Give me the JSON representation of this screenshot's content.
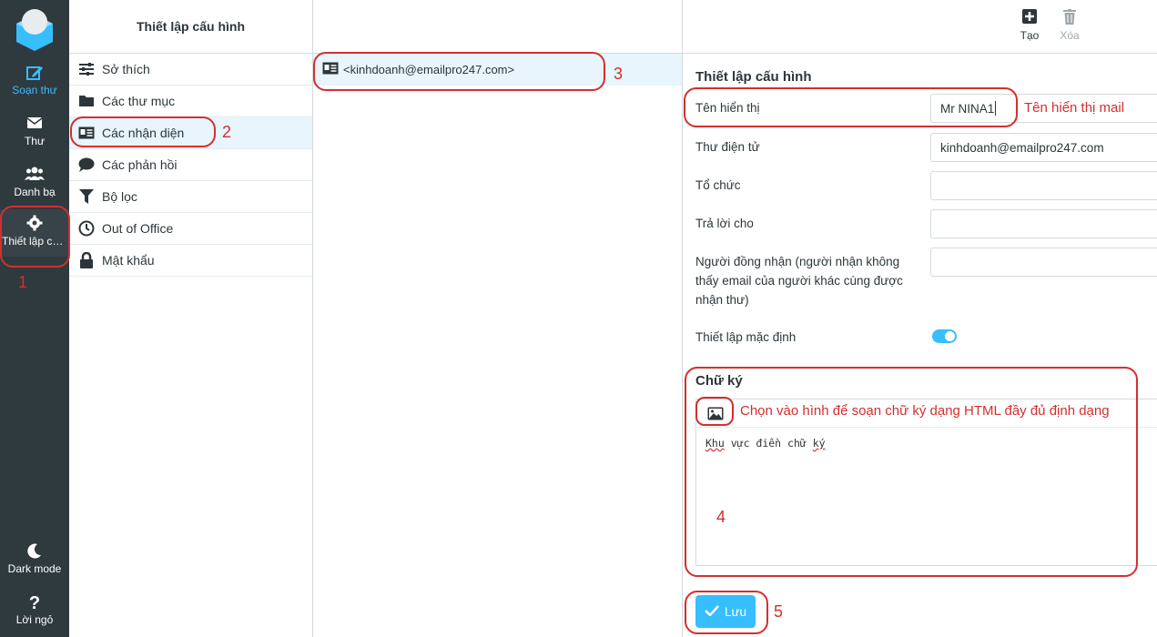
{
  "sidebar": {
    "items": [
      {
        "label": "Soạn thư",
        "icon": "compose-icon"
      },
      {
        "label": "Thư",
        "icon": "mail-icon"
      },
      {
        "label": "Danh bạ",
        "icon": "contacts-icon"
      },
      {
        "label": "Thiết lập cấ...",
        "icon": "gear-icon"
      }
    ],
    "bottom": [
      {
        "label": "Dark mode",
        "icon": "moon-icon"
      },
      {
        "label": "Lời ngỏ",
        "icon": "question-icon"
      }
    ]
  },
  "settings": {
    "title": "Thiết lập cấu hình",
    "items": [
      {
        "label": "Sở thích",
        "icon": "sliders-icon"
      },
      {
        "label": "Các thư mục",
        "icon": "folder-icon"
      },
      {
        "label": "Các nhận diện",
        "icon": "id-card-icon"
      },
      {
        "label": "Các phản hồi",
        "icon": "comment-icon"
      },
      {
        "label": "Bộ lọc",
        "icon": "filter-icon"
      },
      {
        "label": "Out of Office",
        "icon": "clock-icon"
      },
      {
        "label": "Mật khẩu",
        "icon": "lock-icon"
      }
    ]
  },
  "identities": {
    "items": [
      {
        "label": "<kinhdoanh@emailpro247.com>"
      }
    ]
  },
  "toolbar": {
    "create_label": "Tạo",
    "delete_label": "Xóa"
  },
  "form": {
    "title": "Thiết lập cấu hình",
    "fields": {
      "display_name": {
        "label": "Tên hiển thị",
        "value": "Mr NINA1"
      },
      "email": {
        "label": "Thư điện tử",
        "value": "kinhdoanh@emailpro247.com"
      },
      "organization": {
        "label": "Tổ chức",
        "value": ""
      },
      "reply_to": {
        "label": "Trả lời cho",
        "value": ""
      },
      "bcc": {
        "label": "Người đồng nhận (người nhận không thấy email của người khác cùng được nhận thư)",
        "value": ""
      }
    },
    "default_label": "Thiết lập mặc định",
    "default_on": true,
    "signature_title": "Chữ ký",
    "signature_text_1": "Khu",
    "signature_text_2": "vực điền chữ",
    "signature_text_3": "ký",
    "save_label": "Lưu"
  },
  "annotations": {
    "n1": "1",
    "n2": "2",
    "n3": "3",
    "n4": "4",
    "n5": "5",
    "display_name_hint": "Tên hiển thị mail",
    "signature_hint": "Chọn vào hình để soạn chữ ký dạng HTML đầy đủ định dạng"
  },
  "colors": {
    "accent": "#37beff",
    "sidebar_bg": "#2f3a3f",
    "annotation": "#d32f2f",
    "selected_bg": "#e8f5fc"
  }
}
